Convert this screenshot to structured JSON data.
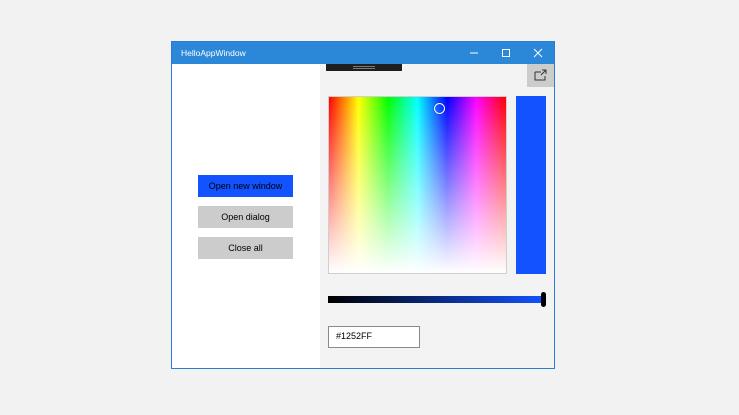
{
  "window": {
    "title": "HelloAppWindow"
  },
  "caption_buttons": {
    "minimize_icon": "minimize-icon",
    "maximize_icon": "maximize-icon",
    "close_icon": "close-icon"
  },
  "left_pane": {
    "buttons": [
      {
        "label": "Open new window",
        "accent": "#1252ff"
      },
      {
        "label": "Open dialog"
      },
      {
        "label": "Close all"
      }
    ]
  },
  "right_pane": {
    "popout_icon": "popout-icon",
    "color_picker": {
      "selected_color": "#1252FF",
      "hex_value": "#1252FF",
      "value_slider_level": 1.0
    }
  }
}
